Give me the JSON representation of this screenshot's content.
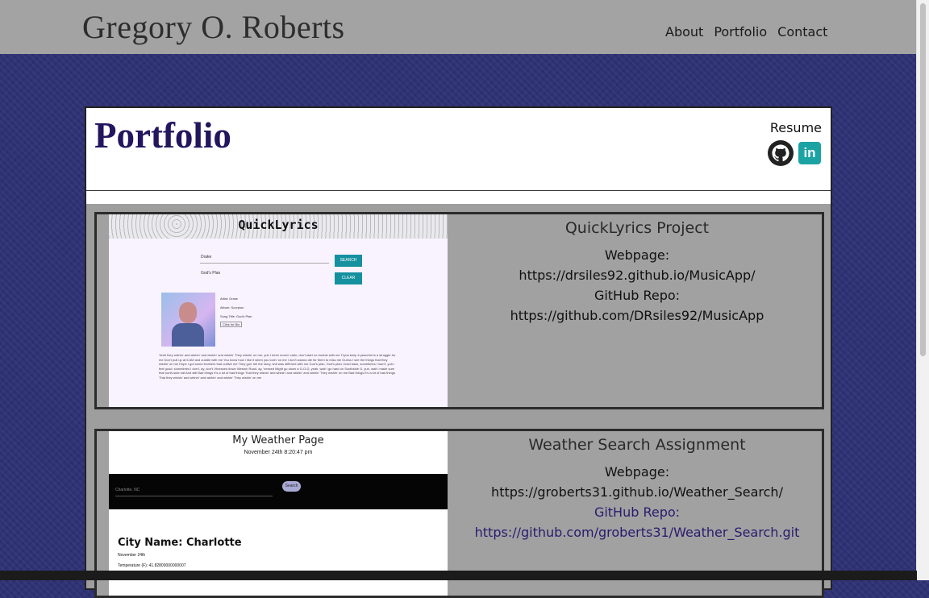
{
  "header": {
    "brand": "Gregory O. Roberts",
    "nav": [
      "About",
      "Portfolio",
      "Contact"
    ]
  },
  "portfolio": {
    "title": "Portfolio",
    "resume_label": "Resume",
    "icons": [
      "github-icon",
      "linkedin-icon"
    ],
    "linkedin_glyph": "in"
  },
  "projects": [
    {
      "title": "QuickLyrics Project",
      "webpage_label": "Webpage:",
      "webpage_url": "https://drsiles92.github.io/MusicApp/",
      "repo_label": "GitHub Repo:",
      "repo_url": "https://github.com/DRsiles92/MusicApp",
      "screenshot": {
        "logo": "QuickLyrics",
        "artist_input": "Drake",
        "song_input": "God's Plan",
        "search_button": "SEARCH",
        "clear_button": "CLEAR",
        "meta": [
          "Artist: Drake",
          "Album: Scorpion",
          "Song Title: God's Plan",
          "Click for Bio"
        ],
        "lyrics": "Yeah they wishin' and wishin' and wishin' and wishin' They wishin' on me, yuh I been movin' calm, don't start no trouble with me Tryna keep it peaceful is a struggle for me Don't pull up at 6 AM and cuddle with me You know how I like it when you lovin' on me I don't wanna die for them to miss me Guess I see the things that they wishin' on me Hope I got some brothers that outlive me They gon' tell the story, shit was different with me God's plan, God's plan I hold back, sometimes I won't, yuh I feel good, sometimes I don't, ay, don't I finessed down Weston Road, ay, 'nessed Might go down a G-O-D, yeah, wait I go hard on Southside G, yuh, wait I make sure that north-side eat And still Bad things It's a lot of bad things That they wishin' and wishin' and wishin' and wishin' They wishin' on me Bad things It's a lot of bad things That they wishin' and wishin' and wishin' and wishin' They wishin' on me"
      }
    },
    {
      "title": "Weather Search Assignment",
      "webpage_label": "Webpage:",
      "webpage_url": "https://groberts31.github.io/Weather_Search/",
      "repo_label": "GitHub Repo:",
      "repo_url": "https://github.com/groberts31/Weather_Search.git",
      "screenshot": {
        "title": "My Weather Page",
        "date": "November 24th 8:20:47 pm",
        "search_placeholder": "Charlotte, NC",
        "search_button": "Search",
        "city": "City Name: Charlotte",
        "day": "November 24th",
        "temp": "Temperature (F): 41.82800000000007"
      }
    }
  ],
  "colors": {
    "background": "#2f3275",
    "header": "#a3a3a3",
    "title": "#23155e",
    "link": "#2a1b6e",
    "linkedin": "#1ba3a3"
  }
}
